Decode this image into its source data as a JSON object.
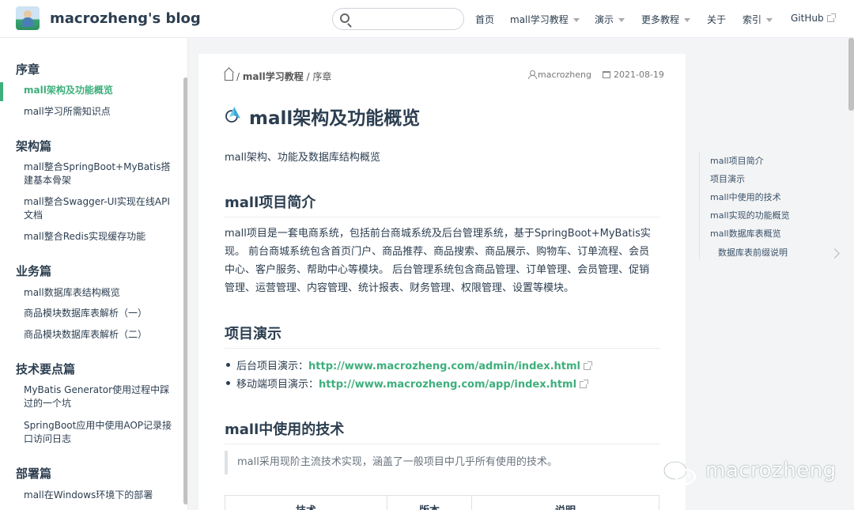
{
  "navbar": {
    "site_name": "macrozheng's blog",
    "search": {
      "value": "",
      "placeholder": ""
    },
    "items": [
      {
        "label": "首页"
      },
      {
        "label": "mall学习教程"
      },
      {
        "label": "演示"
      },
      {
        "label": "更多教程"
      },
      {
        "label": "关于"
      },
      {
        "label": "索引"
      },
      {
        "label": "GitHub"
      }
    ]
  },
  "sidebar": {
    "groups": [
      {
        "title": "序章",
        "items": [
          "mall架构及功能概览",
          "mall学习所需知识点"
        ]
      },
      {
        "title": "架构篇",
        "items": [
          "mall整合SpringBoot+MyBatis搭建基本骨架",
          "mall整合Swagger-UI实现在线API文档",
          "mall整合Redis实现缓存功能"
        ]
      },
      {
        "title": "业务篇",
        "items": [
          "mall数据库表结构概览",
          "商品模块数据库表解析（一）",
          "商品模块数据库表解析（二）"
        ]
      },
      {
        "title": "技术要点篇",
        "items": [
          "MyBatis Generator使用过程中踩过的一个坑",
          "SpringBoot应用中使用AOP记录接口访问日志"
        ]
      },
      {
        "title": "部署篇",
        "items": [
          "mall在Windows环境下的部署"
        ]
      }
    ],
    "active_item": "mall架构及功能概览"
  },
  "breadcrumb": {
    "sep": "/",
    "section": "mall学习教程",
    "page": "序章"
  },
  "meta": {
    "author": "macrozheng",
    "date": "2021-08-19"
  },
  "article": {
    "title": "mall架构及功能概览",
    "description": "mall架构、功能及数据库结构概览",
    "sections": {
      "intro": {
        "heading": "mall项目简介",
        "lines": [
          "mall项目是一套电商系统，包括前台商城系统及后台管理系统，基于SpringBoot+MyBatis实",
          "现。 前台商城系统包含首页门户、商品推荐、商品搜索、商品展示、购物车、订单流程、会员",
          "中心、客户服务、帮助中心等模块。 后台管理系统包含商品管理、订单管理、会员管理、促销",
          "管理、运营管理、内容管理、统计报表、财务管理、权限管理、设置等模块。"
        ]
      },
      "demo": {
        "heading": "项目演示",
        "items": [
          {
            "label": "后台项目演示：",
            "url": "http://www.macrozheng.com/admin/index.html"
          },
          {
            "label": "移动端项目演示：",
            "url": "http://www.macrozheng.com/app/index.html"
          }
        ]
      },
      "tech": {
        "heading": "mall中使用的技术",
        "quote": "mall采用现阶主流技术实现，涵盖了一般项目中几乎所有使用的技术。",
        "table_headers": [
          "技术",
          "版本",
          "说明"
        ]
      }
    }
  },
  "toc": {
    "items": [
      "mall项目简介",
      "项目演示",
      "mall中使用的技术",
      "mall实现的功能概览",
      "mall数据库表概览"
    ],
    "sub_items": [
      "数据库表前缀说明"
    ]
  },
  "watermark": {
    "text": "macrozheng"
  },
  "colors": {
    "accent": "#3eaf7c",
    "text": "#2c3e50"
  }
}
